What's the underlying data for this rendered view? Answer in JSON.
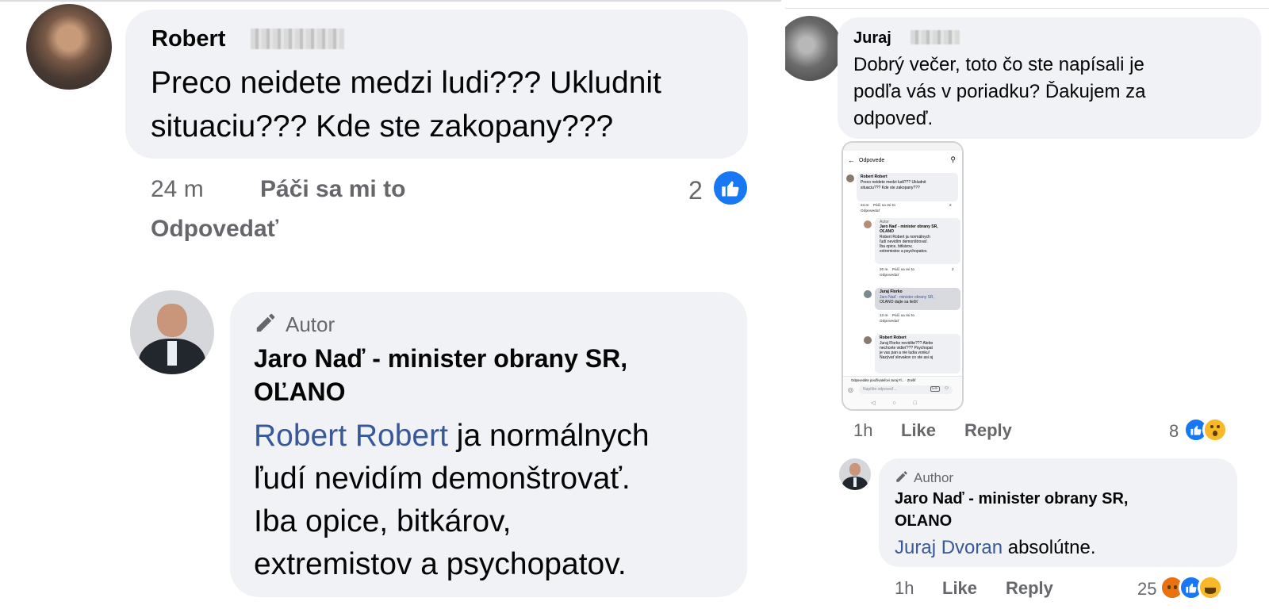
{
  "left": {
    "comment1": {
      "name": "Robert",
      "text_line1": "Preco neidete medzi ludi??? Ukludnit",
      "text_line2": "situaciu??? Kde ste zakopany???",
      "time": "24 m",
      "like_label": "Páči sa mi to",
      "reply_label": "Odpovedať",
      "reaction_count": "2"
    },
    "reply1": {
      "badge": "Autor",
      "author_line1": "Jaro Naď - minister obrany SR,",
      "author_line2": "OĽANO",
      "mention": "Robert Robert",
      "text_after_mention": " ja normálnych",
      "text_line2": "ľudí nevidím demonštrovať.",
      "text_line3": "Iba opice, bitkárov,",
      "text_line4": "extremistov a psychopatov."
    }
  },
  "right": {
    "comment1": {
      "name": "Juraj",
      "text_line1": "Dobrý večer, toto čo ste napísali je",
      "text_line2": "podľa vás v poriadku? Ďakujem za",
      "text_line3": "odpoveď.",
      "time": "1h",
      "like_label": "Like",
      "reply_label": "Reply",
      "reaction_count": "8"
    },
    "screenshot": {
      "header": "Odpovede",
      "c1_name": "Robert Robert",
      "c1_l1": "Preco neidete medzi ludi??? Ukludnit",
      "c1_l2": "situaciu??? Kde ste zakopany???",
      "c1_time": "24 m",
      "c1_like": "Páči sa mi to",
      "c1_reply": "Odpovedať",
      "c1_count": "2",
      "r1_badge": "Autor",
      "r1_author1": "Jaro Naď - minister obrany SR,",
      "r1_author2": "OĽANO",
      "r1_l1": "Robert Robert ja normálnych",
      "r1_l2": "ľudí nevidím demonštrovať.",
      "r1_l3": "Iba opice, bitkárov,",
      "r1_l4": "extremistov a psychopatov.",
      "r1_time": "20 m",
      "r1_like": "Páči sa mi to",
      "r1_reply": "Odpovedať",
      "r1_count": "2",
      "r2_name": "Juraj Florko",
      "r2_l1": "Jaro Naď - minister obrany SR,",
      "r2_l2": "OĽANO dajte sa liečiť",
      "r2_time": "13 m",
      "r2_like": "Páči sa mi to",
      "r2_reply": "Odpovedať",
      "r3_name": "Robert Robert",
      "r3_l1": "Juraj Florko nevidíte??? Alebo",
      "r3_l2": "nechcete vidieť??? Psychopat",
      "r3_l3": "je vas pan a nie ludia vonku!",
      "r3_l4": "Nazývať slovakov co ste asi aj",
      "replying_to": "Odpovedáte používateľovi Juraj Fl... · Zrušiť",
      "input_placeholder": "Napíšte odpoveď..."
    },
    "reply1": {
      "badge": "Author",
      "author_line1": "Jaro Naď - minister obrany SR,",
      "author_line2": "OĽANO",
      "mention": "Juraj Dvoran",
      "text_after_mention": " absolútne.",
      "time": "1h",
      "like_label": "Like",
      "reply_label": "Reply",
      "reaction_count": "25"
    }
  },
  "colors": {
    "bubble": "#f0f2f5",
    "meta": "#65676b",
    "link": "#385898",
    "like_blue": "#1877f2"
  },
  "icons": [
    "pencil-icon",
    "like-reaction-icon",
    "wow-reaction-icon",
    "angry-reaction-icon",
    "haha-reaction-icon",
    "search-icon",
    "back-arrow-icon",
    "camera-icon",
    "gif-icon",
    "emoji-icon"
  ]
}
